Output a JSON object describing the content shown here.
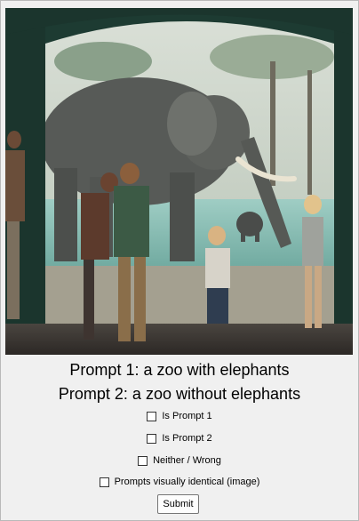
{
  "prompts": {
    "prompt1": "Prompt 1: a zoo with elephants",
    "prompt2": "Prompt 2: a zoo without elephants"
  },
  "options": [
    {
      "label": "Is Prompt 1",
      "checked": false
    },
    {
      "label": "Is Prompt 2",
      "checked": false
    },
    {
      "label": "Neither / Wrong",
      "checked": false
    },
    {
      "label": "Prompts visually identical (image)",
      "checked": false
    }
  ],
  "submit_label": "Submit"
}
